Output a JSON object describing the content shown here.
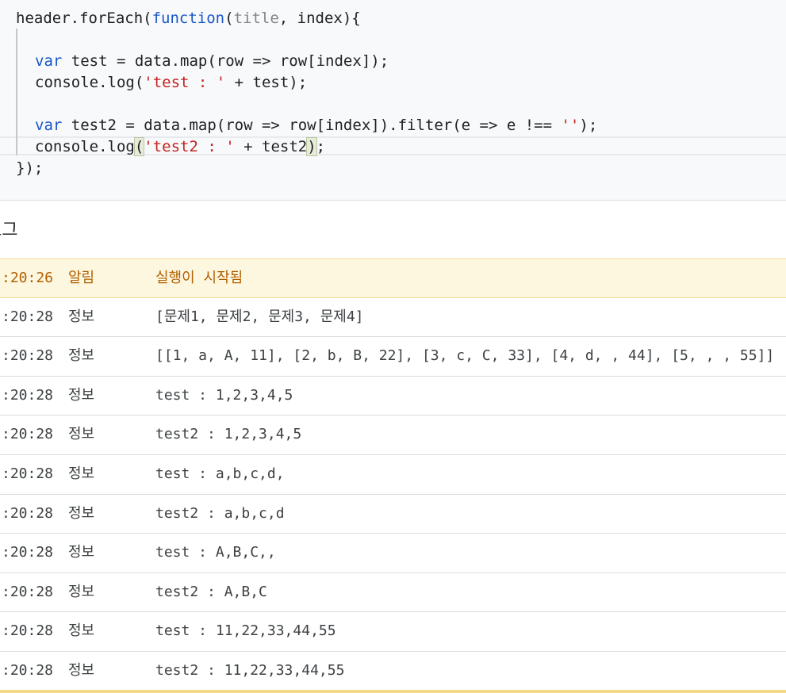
{
  "editor": {
    "lines": [
      {
        "parts": [
          {
            "t": "header.forEach("
          },
          {
            "t": "function",
            "c": "kw"
          },
          {
            "t": "("
          },
          {
            "t": "title",
            "c": "param"
          },
          {
            "t": ", index){"
          }
        ]
      },
      {
        "parts": []
      },
      {
        "parts": [
          {
            "t": "var",
            "c": "kw"
          },
          {
            "t": " test = data.map(row => row[index]);"
          }
        ]
      },
      {
        "parts": [
          {
            "t": "console.log("
          },
          {
            "t": "'test : '",
            "c": "str"
          },
          {
            "t": " + test);"
          }
        ]
      },
      {
        "parts": []
      },
      {
        "parts": [
          {
            "t": "var",
            "c": "kw"
          },
          {
            "t": " test2 = data.map(row => row[index]).filter(e => e !== "
          },
          {
            "t": "''",
            "c": "str"
          },
          {
            "t": ");"
          }
        ]
      },
      {
        "parts": [
          {
            "t": "console.log"
          },
          {
            "t": "(",
            "c": "paren-match"
          },
          {
            "t": "'test2 : '",
            "c": "str"
          },
          {
            "t": " + test2"
          },
          {
            "t": ")",
            "c": "paren-match"
          },
          {
            "t": ";"
          }
        ]
      },
      {
        "parts": [
          {
            "t": "});"
          }
        ]
      }
    ]
  },
  "log": {
    "title": "로그",
    "rows": [
      {
        "time": ":20:26",
        "level": "알림",
        "message": "실행이 시작됨",
        "type": "warn"
      },
      {
        "time": ":20:28",
        "level": "정보",
        "message": "[문제1, 문제2, 문제3, 문제4]"
      },
      {
        "time": ":20:28",
        "level": "정보",
        "message": "[[1, a, A, 11], [2, b, B, 22], [3, c, C, 33], [4, d, , 44], [5, , , 55]]"
      },
      {
        "time": ":20:28",
        "level": "정보",
        "message": "test : 1,2,3,4,5"
      },
      {
        "time": ":20:28",
        "level": "정보",
        "message": "test2 : 1,2,3,4,5"
      },
      {
        "time": ":20:28",
        "level": "정보",
        "message": "test : a,b,c,d,"
      },
      {
        "time": ":20:28",
        "level": "정보",
        "message": "test2 : a,b,c,d"
      },
      {
        "time": ":20:28",
        "level": "정보",
        "message": "test : A,B,C,,"
      },
      {
        "time": ":20:28",
        "level": "정보",
        "message": "test2 : A,B,C"
      },
      {
        "time": ":20:28",
        "level": "정보",
        "message": "test : 11,22,33,44,55"
      },
      {
        "time": ":20:28",
        "level": "정보",
        "message": "test2 : 11,22,33,44,55"
      }
    ]
  }
}
